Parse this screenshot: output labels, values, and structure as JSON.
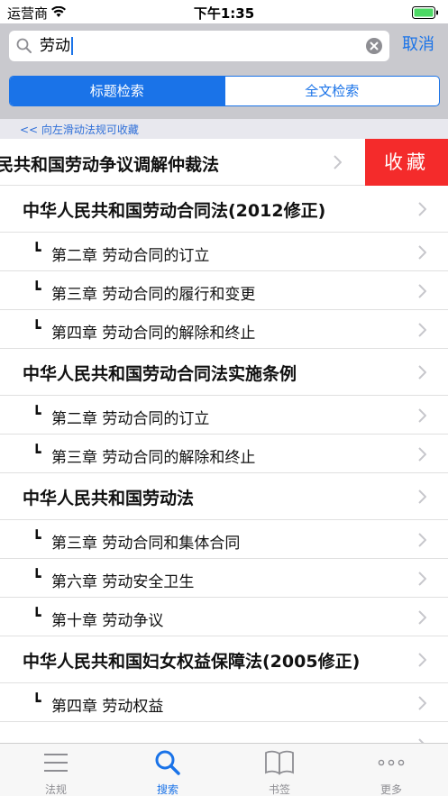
{
  "status_bar": {
    "carrier": "运营商",
    "time": "下午1:35"
  },
  "search": {
    "query": "劳动",
    "cancel_label": "取消"
  },
  "segments": [
    {
      "label": "标题检索",
      "active": true
    },
    {
      "label": "全文检索",
      "active": false
    }
  ],
  "hint": "<<  向左滑动法规可收藏",
  "swipe_row": {
    "title": "民共和国劳动争议调解仲裁法",
    "fav_label": "收藏"
  },
  "rows": [
    {
      "type": "title",
      "text": "中华人民共和国劳动合同法(2012修正)"
    },
    {
      "type": "sub",
      "text": "第二章 劳动合同的订立"
    },
    {
      "type": "sub",
      "text": "第三章 劳动合同的履行和变更"
    },
    {
      "type": "sub",
      "text": "第四章 劳动合同的解除和终止"
    },
    {
      "type": "title",
      "text": "中华人民共和国劳动合同法实施条例"
    },
    {
      "type": "sub",
      "text": "第二章 劳动合同的订立"
    },
    {
      "type": "sub",
      "text": "第三章 劳动合同的解除和终止"
    },
    {
      "type": "title",
      "text": "中华人民共和国劳动法"
    },
    {
      "type": "sub",
      "text": "第三章 劳动合同和集体合同"
    },
    {
      "type": "sub",
      "text": "第六章 劳动安全卫生"
    },
    {
      "type": "sub",
      "text": "第十章 劳动争议"
    },
    {
      "type": "title",
      "text": "中华人民共和国妇女权益保障法(2005修正)"
    },
    {
      "type": "sub",
      "text": "第四章 劳动权益"
    },
    {
      "type": "title",
      "text": ""
    }
  ],
  "tabs": [
    {
      "label": "法规",
      "icon": "list-icon",
      "active": false
    },
    {
      "label": "搜索",
      "icon": "search-icon",
      "active": true
    },
    {
      "label": "书签",
      "icon": "book-icon",
      "active": false
    },
    {
      "label": "更多",
      "icon": "more-icon",
      "active": false
    }
  ],
  "colors": {
    "accent": "#1a73e8",
    "favorite": "#f42b2b",
    "battery": "#4cd964"
  }
}
